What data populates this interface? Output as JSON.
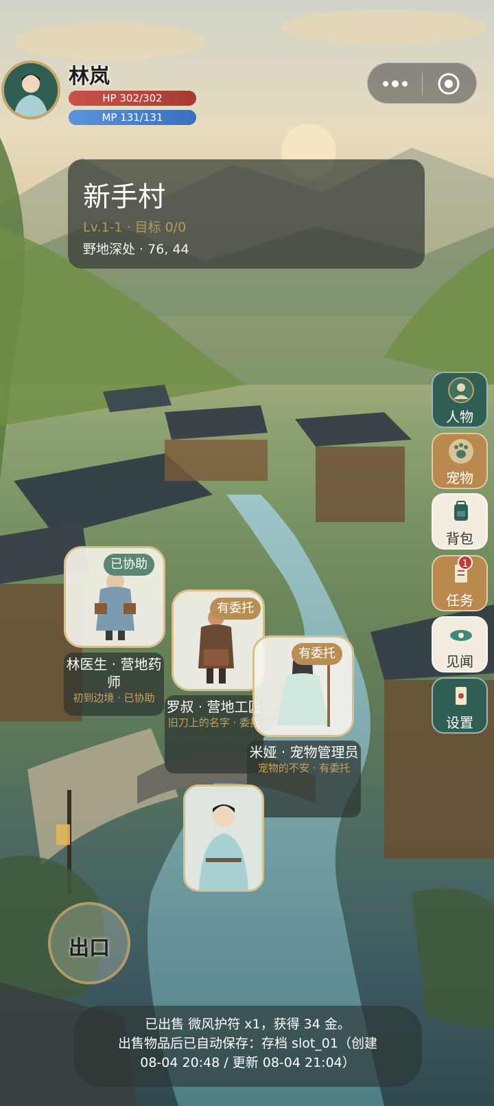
{
  "player": {
    "name": "林岚",
    "hp_text": "HP 302/302",
    "hp_ratio": 1.0,
    "mp_text": "MP 131/131",
    "mp_ratio": 1.0
  },
  "capsule": {
    "more_icon": "more-dots-icon",
    "close_icon": "target-close-icon"
  },
  "location": {
    "title": "新手村",
    "level": "Lv.1-1 · 目标 0/0",
    "coords": "野地深处 · 76, 44"
  },
  "menu": [
    {
      "label": "人物",
      "icon": "character-icon",
      "style": "green"
    },
    {
      "label": "宠物",
      "icon": "pet-icon",
      "style": "gold"
    },
    {
      "label": "背包",
      "icon": "backpack-icon",
      "style": "cream"
    },
    {
      "label": "任务",
      "icon": "quest-icon",
      "style": "gold",
      "badge": "1"
    },
    {
      "label": "见闻",
      "icon": "news-icon",
      "style": "cream"
    },
    {
      "label": "设置",
      "icon": "settings-icon",
      "style": "green"
    }
  ],
  "npcs": [
    {
      "tag": "已协助",
      "name": "林医生 · 营地药师",
      "sub": "初到边境 · 已协助"
    },
    {
      "tag": "有委托",
      "name": "罗叔 · 营地工匠",
      "sub": "旧刀上的名字 · 委托"
    },
    {
      "tag": "有委托",
      "name": "米娅 · 宠物管理员",
      "sub": "宠物的不安 · 有委托"
    }
  ],
  "exit": {
    "label": "出口"
  },
  "log": {
    "line1": "已出售 微风护符 x1，获得 34 金。",
    "line2": "出售物品后已自动保存：存档 slot_01（创建",
    "line3": "08-04 20:48 / 更新 08-04 21:04）"
  },
  "colors": {
    "hp": "#b8403a",
    "mp": "#3f74c4",
    "panel": "#343a36",
    "gold_accent": "#c8a56a",
    "menu_green": "#2f5e55",
    "menu_gold": "#b9894d",
    "menu_cream": "#f3ece0"
  }
}
